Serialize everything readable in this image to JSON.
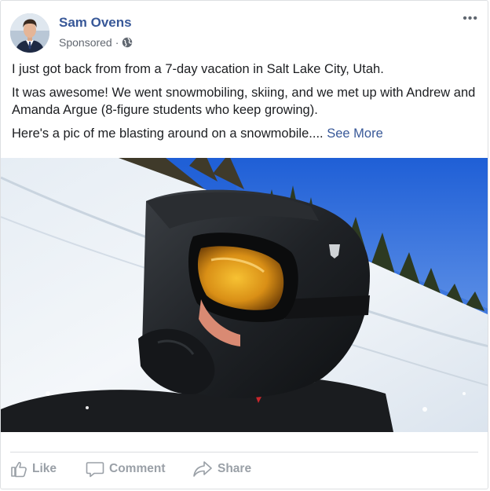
{
  "post": {
    "author": "Sam Ovens",
    "sponsored_label": "Sponsored",
    "separator": "·",
    "paragraphs": [
      "I just got back from from a 7-day vacation in Salt Lake City, Utah.",
      "It was awesome! We went snowmobiling, skiing, and we met up with Andrew and Amanda Argue (8-figure students who keep growing).",
      "Here's a pic of me blasting around on a snowmobile...."
    ],
    "see_more": "See More",
    "more_options": "•••"
  },
  "actions": {
    "like": "Like",
    "comment": "Comment",
    "share": "Share"
  },
  "icons": {
    "globe": "globe-icon",
    "more": "more-options-icon",
    "like": "thumbs-up-icon",
    "comment": "speech-bubble-icon",
    "share": "share-arrow-icon"
  },
  "colors": {
    "author": "#385898",
    "link": "#385898",
    "meta": "#616770",
    "action": "#9aa0a7"
  }
}
